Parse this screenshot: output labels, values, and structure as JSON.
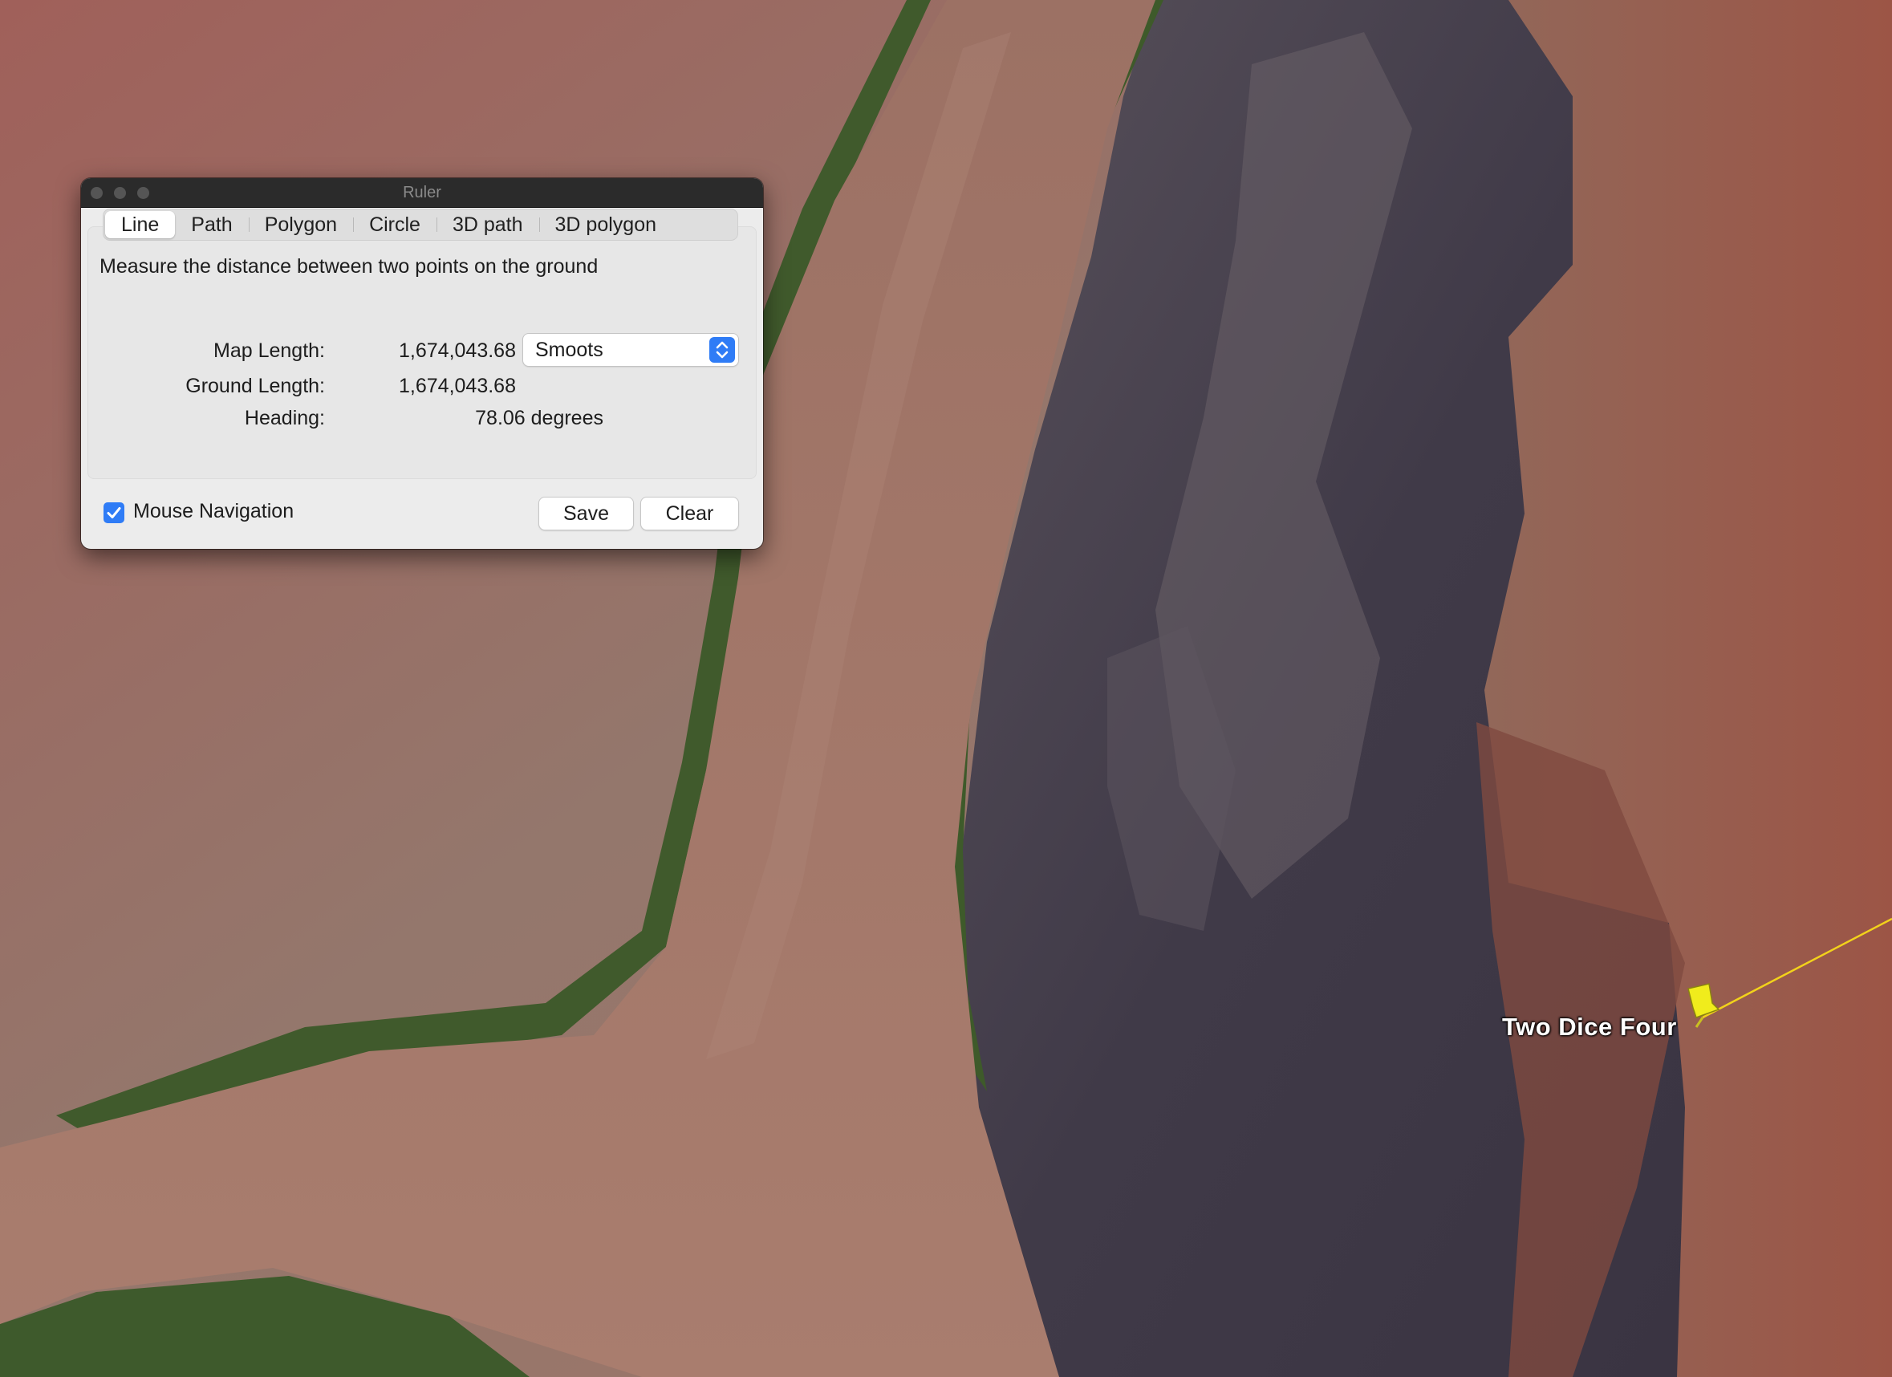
{
  "window": {
    "title": "Ruler",
    "tabs": [
      {
        "label": "Line",
        "active": true
      },
      {
        "label": "Path",
        "active": false
      },
      {
        "label": "Polygon",
        "active": false
      },
      {
        "label": "Circle",
        "active": false
      },
      {
        "label": "3D path",
        "active": false
      },
      {
        "label": "3D polygon",
        "active": false
      }
    ],
    "description": "Measure the distance between two points on the ground",
    "map_length": {
      "label": "Map Length:",
      "value": "1,674,043.68"
    },
    "ground_length": {
      "label": "Ground Length:",
      "value": "1,674,043.68"
    },
    "heading": {
      "label": "Heading:",
      "value": "78.06 degrees"
    },
    "unit_select": {
      "value": "Smoots"
    },
    "mouse_navigation": {
      "label": "Mouse Navigation",
      "checked": true
    },
    "save_label": "Save",
    "clear_label": "Clear"
  },
  "map": {
    "placemark": {
      "label": "Two Dice Four",
      "color": "#f0ec1c"
    },
    "measure_line_color": "#f2d21b",
    "river_color": "#a5786a",
    "terrain_color": "#8c5a4c",
    "canyon_shadow_color": "#423c4a",
    "vegetation_color": "#3f5a2a"
  },
  "colors": {
    "accent": "#2f7cf6",
    "titlebar": "#2b2b2b",
    "window_bg": "#ececec"
  }
}
